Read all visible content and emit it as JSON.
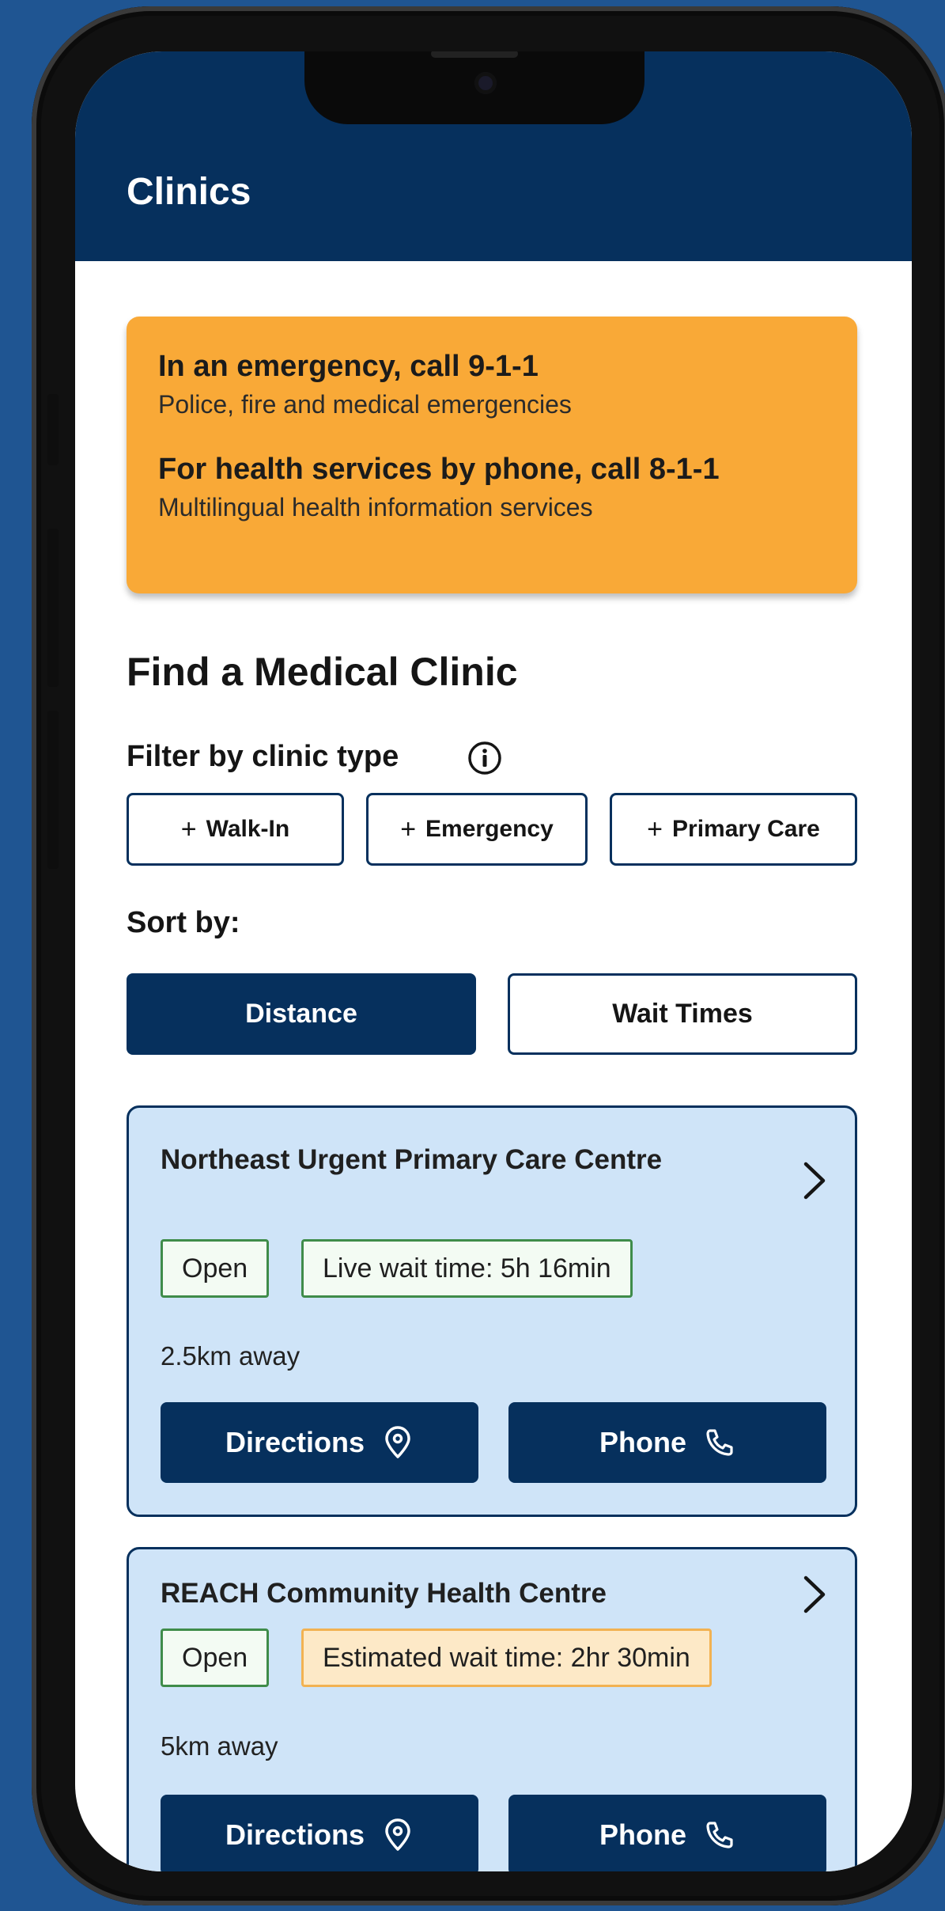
{
  "app": {
    "title": "Clinics"
  },
  "alert": {
    "line1_title": "In an emergency, call 9-1-1",
    "line1_sub": "Police, fire and medical emergencies",
    "line2_title": "For health services by phone, call 8-1-1",
    "line2_sub": "Multilingual health information services"
  },
  "finder": {
    "title": "Find a Medical Clinic",
    "filter_label": "Filter by clinic type",
    "filters": [
      {
        "label": "Walk-In"
      },
      {
        "label": "Emergency"
      },
      {
        "label": "Primary Care"
      }
    ],
    "plus": "+",
    "sort_label": "Sort by:",
    "sort_options": [
      {
        "label": "Distance",
        "selected": true
      },
      {
        "label": "Wait Times",
        "selected": false
      }
    ]
  },
  "clinics": [
    {
      "name": "Northeast Urgent Primary Care Centre",
      "status": "Open",
      "wait": "Live wait time: 5h 16min",
      "distance": "2.5km away",
      "directions_label": "Directions",
      "phone_label": "Phone"
    },
    {
      "name": "REACH Community Health Centre",
      "status": "Open",
      "wait": "Estimated wait time: 2hr 30min",
      "distance": "5km away",
      "directions_label": "Directions",
      "phone_label": "Phone"
    }
  ],
  "colors": {
    "background": "#1f5592",
    "appbar": "#06305d",
    "alert": "#f9a937",
    "card": "#cfe4f8",
    "pointer": "#e3a80d"
  }
}
